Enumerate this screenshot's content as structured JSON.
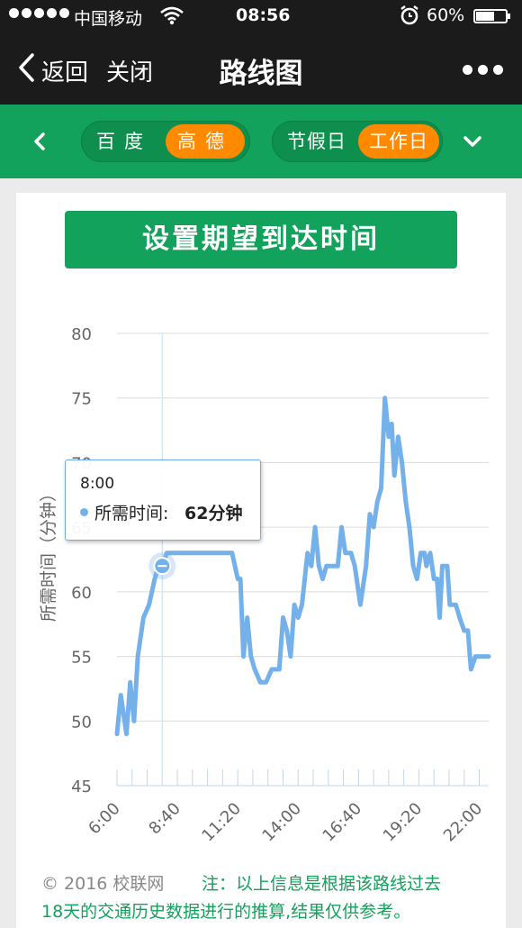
{
  "status_bar": {
    "carrier": "中国移动",
    "time": "08:56",
    "battery_text": "60%",
    "battery_level": 0.6,
    "signal_bars": 5
  },
  "nav": {
    "back_label": "返回",
    "close_label": "关闭",
    "title": "路线图",
    "icons": [
      "chevron-left-icon",
      "more-icon"
    ]
  },
  "toolbar": {
    "provider_options": [
      "百度",
      "高德"
    ],
    "provider_selected": "高德",
    "daytype_options": [
      "节假日",
      "工作日"
    ],
    "daytype_selected": "工作日",
    "icons": [
      "chevron-left-icon",
      "chevron-down-icon"
    ]
  },
  "card": {
    "set_time_button": "设置期望到达时间"
  },
  "tooltip": {
    "time": "8:00",
    "label": "所需时间:",
    "value": "62分钟"
  },
  "footer": {
    "copyright": "© 2016 校联网",
    "note_line1": "注：以上信息是根据该路线过去",
    "note_line2": "18天的交通历史数据进行的推算,结果仅供参考。"
  },
  "colors": {
    "green": "#13a25b",
    "orange": "#ff8a00",
    "line_blue": "#74b1ea",
    "dark_bar": "#1b1b1b"
  },
  "chart_data": {
    "type": "line",
    "ylabel": "所需时间（分钟）",
    "ylim": [
      45,
      80
    ],
    "yticks": [
      45,
      50,
      55,
      60,
      65,
      70,
      75,
      80
    ],
    "xlim": [
      360,
      1345
    ],
    "xticks": [
      {
        "minutes": 360,
        "label": "6:00"
      },
      {
        "minutes": 520,
        "label": "8:40"
      },
      {
        "minutes": 680,
        "label": "11:20"
      },
      {
        "minutes": 840,
        "label": "14:00"
      },
      {
        "minutes": 1000,
        "label": "16:40"
      },
      {
        "minutes": 1160,
        "label": "19:20"
      },
      {
        "minutes": 1320,
        "label": "22:00"
      }
    ],
    "highlight": {
      "minutes": 480,
      "value": 62
    },
    "series": [
      {
        "points": [
          [
            360,
            49
          ],
          [
            370,
            52
          ],
          [
            385,
            49
          ],
          [
            395,
            53
          ],
          [
            405,
            50
          ],
          [
            415,
            55
          ],
          [
            430,
            58
          ],
          [
            445,
            59
          ],
          [
            460,
            61
          ],
          [
            470,
            62
          ],
          [
            480,
            62
          ],
          [
            492,
            63
          ],
          [
            510,
            63
          ],
          [
            520,
            63
          ],
          [
            540,
            63
          ],
          [
            560,
            63
          ],
          [
            580,
            63
          ],
          [
            600,
            63
          ],
          [
            620,
            63
          ],
          [
            640,
            63
          ],
          [
            665,
            63
          ],
          [
            680,
            61
          ],
          [
            687,
            61
          ],
          [
            695,
            55
          ],
          [
            705,
            58
          ],
          [
            715,
            55
          ],
          [
            725,
            54
          ],
          [
            740,
            53
          ],
          [
            755,
            53
          ],
          [
            770,
            54
          ],
          [
            790,
            54
          ],
          [
            800,
            58
          ],
          [
            810,
            57
          ],
          [
            820,
            55
          ],
          [
            830,
            59
          ],
          [
            840,
            58
          ],
          [
            850,
            59
          ],
          [
            865,
            63
          ],
          [
            875,
            62
          ],
          [
            885,
            65
          ],
          [
            895,
            62
          ],
          [
            905,
            61
          ],
          [
            915,
            62
          ],
          [
            930,
            62
          ],
          [
            945,
            62
          ],
          [
            955,
            65
          ],
          [
            965,
            63
          ],
          [
            980,
            63
          ],
          [
            990,
            62
          ],
          [
            1005,
            59
          ],
          [
            1020,
            62
          ],
          [
            1030,
            66
          ],
          [
            1040,
            65
          ],
          [
            1050,
            67
          ],
          [
            1060,
            68
          ],
          [
            1070,
            75
          ],
          [
            1080,
            72
          ],
          [
            1088,
            73
          ],
          [
            1095,
            69
          ],
          [
            1105,
            72
          ],
          [
            1115,
            70
          ],
          [
            1125,
            67
          ],
          [
            1135,
            65
          ],
          [
            1145,
            62
          ],
          [
            1155,
            61
          ],
          [
            1165,
            63
          ],
          [
            1175,
            63
          ],
          [
            1180,
            62
          ],
          [
            1190,
            63
          ],
          [
            1200,
            61
          ],
          [
            1208,
            61
          ],
          [
            1215,
            58
          ],
          [
            1222,
            62
          ],
          [
            1235,
            62
          ],
          [
            1242,
            59
          ],
          [
            1258,
            59
          ],
          [
            1268,
            58
          ],
          [
            1280,
            57
          ],
          [
            1290,
            57
          ],
          [
            1298,
            54
          ],
          [
            1310,
            55
          ],
          [
            1345,
            55
          ]
        ]
      }
    ]
  }
}
